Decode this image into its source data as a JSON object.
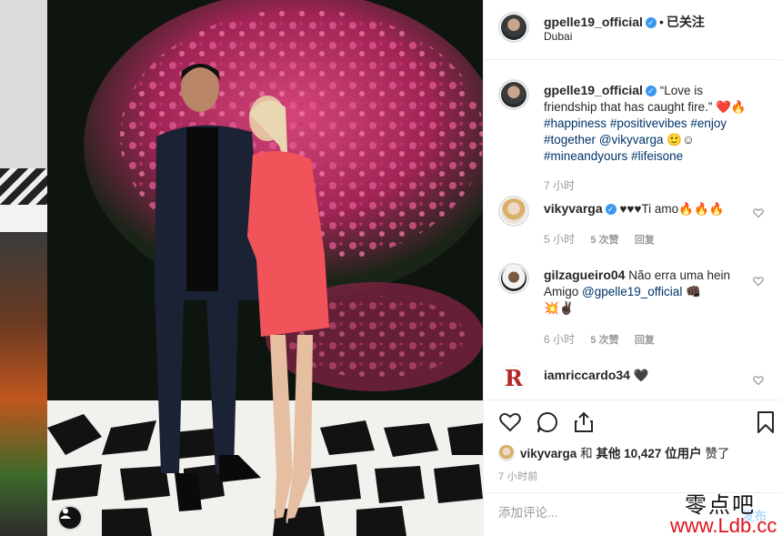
{
  "post": {
    "username": "gpelle19_official",
    "follow_status": "已关注",
    "separator": "•",
    "location": "Dubai",
    "verified_icon": "verified-badge-icon"
  },
  "caption": {
    "username": "gpelle19_official",
    "quote": "“Love is friendship that has caught fire.”",
    "emojis": "❤️🔥",
    "hashtags": [
      "#happiness",
      "#positivevibes",
      "#enjoy",
      "#together"
    ],
    "mention": "@vikyvarga",
    "mention_emojis": "🙂☺",
    "hashtags2": [
      "#mineandyours",
      "#lifeisone"
    ],
    "time": "7 小时"
  },
  "comments": [
    {
      "username": "vikyvarga",
      "verified": true,
      "text": "♥♥♥Ti amo🔥🔥🔥",
      "time": "5 小时",
      "likes": "5 次赞",
      "reply": "回复"
    },
    {
      "username": "gilzagueiro04",
      "verified": false,
      "text": "Não erra uma hein Amigo",
      "mention": "@gpelle19_official",
      "emojis": "👊🏿",
      "emojis2": "💥✌🏿",
      "time": "6 小时",
      "likes": "5 次赞",
      "reply": "回复"
    },
    {
      "username": "iamriccardo34",
      "verified": false,
      "text": "🖤",
      "avatar_letter": "R"
    }
  ],
  "likes": {
    "liker": "vikyvarga",
    "conj": "和",
    "others_prefix": "其他",
    "count": "10,427",
    "others_suffix": "位用户",
    "verb": "赞了"
  },
  "post_time": "7 小时前",
  "add_comment": {
    "placeholder": "添加评论...",
    "post_label": "发布"
  },
  "watermark": {
    "cn": "零点吧",
    "url": "www.Ldb.cc"
  },
  "colors": {
    "verified": "#3897f0",
    "hashtag": "#003569",
    "meta": "#999999",
    "watermark_url": "#e0121a",
    "heart_red": "#ed4956"
  }
}
